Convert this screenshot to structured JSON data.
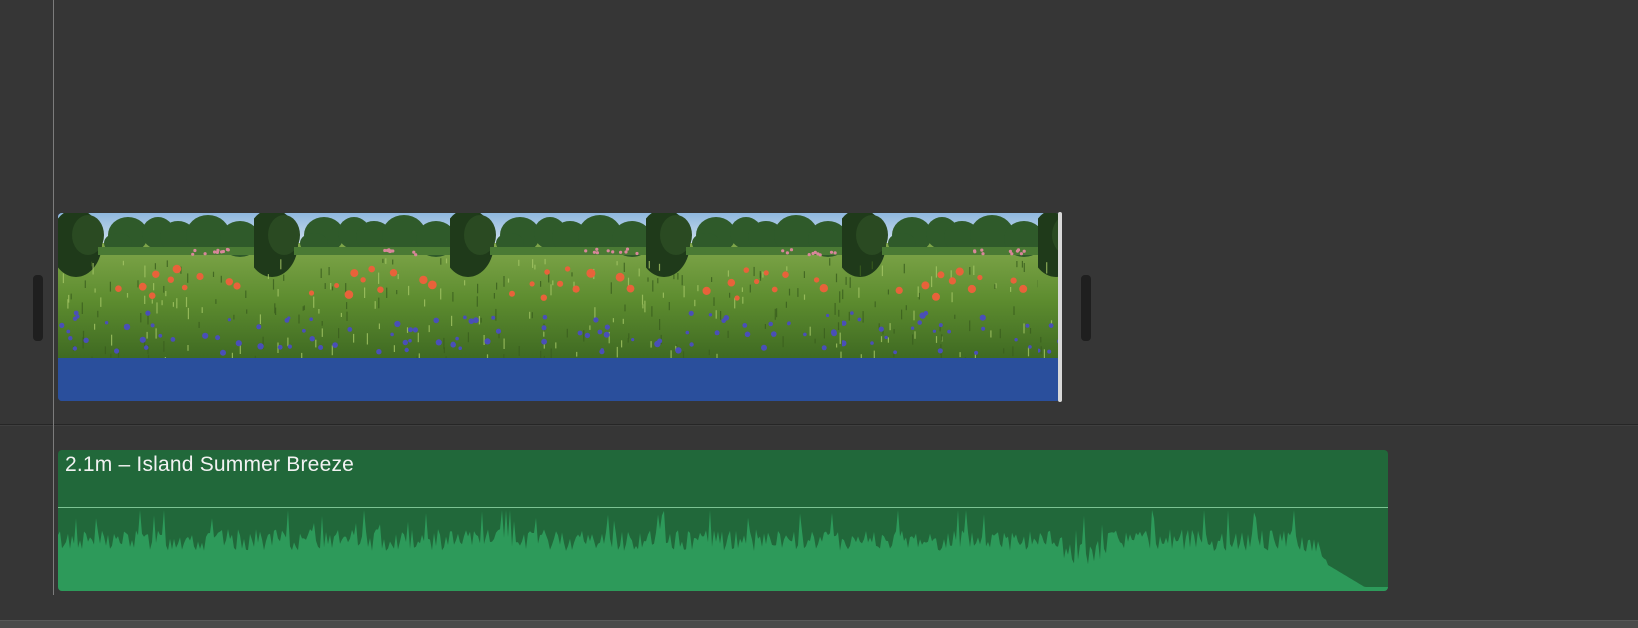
{
  "audio_clip": {
    "title": "2.1m – Island Summer Breeze"
  },
  "video_clip": {
    "thumbnail_count": 5,
    "thumbnail_subject": "wildflower-meadow"
  },
  "colors": {
    "background": "#363636",
    "video_clip_bar": "#2a4f9c",
    "audio_clip": "#21683a",
    "waveform": "#2d9a5a",
    "playhead": "#7c7c7c"
  }
}
